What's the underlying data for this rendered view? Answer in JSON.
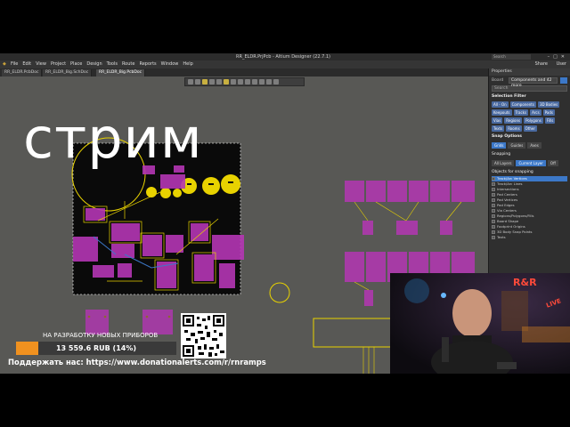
{
  "window": {
    "title": "RR_ELDR.PrjPcb - Altium Designer (22.7.1)",
    "search_placeholder": "Search",
    "user": "User"
  },
  "menubar": {
    "items": [
      "File",
      "Edit",
      "View",
      "Project",
      "Place",
      "Design",
      "Tools",
      "Route",
      "Reports",
      "Window",
      "Help"
    ],
    "share_label": "Share",
    "user_label": "User"
  },
  "tabs": [
    "RR_ELDR.PcbDoc",
    "RR_ELDR_Big.SchDoc",
    "RR_ELDR_Big.PcbDoc"
  ],
  "canvas": {
    "overlay_title": "стрим"
  },
  "properties_panel": {
    "header": "Properties",
    "board_label": "Board",
    "board_value": "Components and 42 more",
    "search_placeholder": "Search",
    "selection_filter_title": "Selection Filter",
    "filter_chips": [
      "All - On",
      "Components",
      "3D Bodies",
      "Keepouts",
      "Tracks",
      "Arcs",
      "Pads",
      "Vias",
      "Regions",
      "Polygons",
      "Fills",
      "Texts",
      "Rooms",
      "Other"
    ],
    "snap_title": "Snap Options",
    "snap_modes": [
      "Grids",
      "Guides",
      "Axes"
    ],
    "snapping_label": "Snapping",
    "snapping_modes": [
      "All Layers",
      "Current Layer",
      "Off"
    ],
    "objects_title": "Objects for snapping",
    "objects": [
      "Track/Arc Vertices",
      "Track/Arc Lines",
      "Intersections",
      "Pad Centers",
      "Pad Vertices",
      "Pad Edges",
      "Via Centers",
      "Regions/Polygons/Fills",
      "Board Shape",
      "Footprint Origins",
      "3D Body Snap Points",
      "Texts"
    ]
  },
  "donation": {
    "title": "НА РАЗРАБОТКУ НОВЫХ ПРИБОРОВ",
    "amount": "13 559.6 RUB (14%)",
    "progress_fraction": 0.14,
    "support_text": "Поддержать нас: https://www.donationalerts.com/r/rnramps",
    "accent_color": "#f0911f"
  },
  "webcam": {
    "sign_text": "R&R",
    "live_text": "LIVE"
  },
  "colors": {
    "pcb_board": "#0a0a0a",
    "pcb_pad": "#b436b4",
    "pcb_component": "#e8d200",
    "canvas_bg": "#585855",
    "selection_blue": "#3c78c8"
  }
}
